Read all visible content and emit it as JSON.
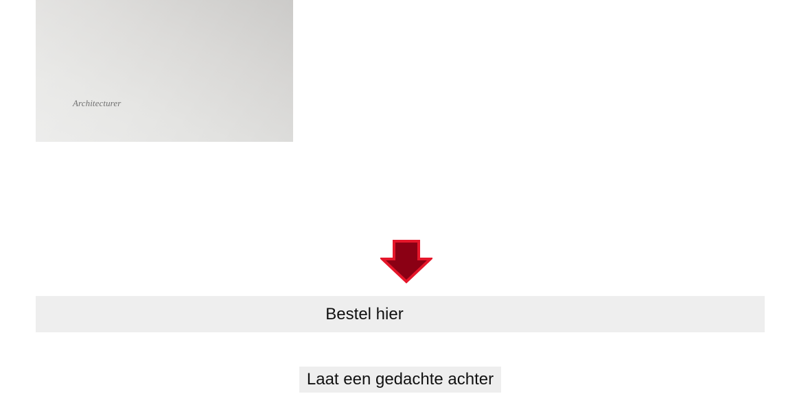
{
  "product_image": {
    "caption": "Architecturer"
  },
  "arrow": {
    "icon": "down-arrow-icon",
    "fill_color": "#8b0014",
    "stroke_color": "#e5162a"
  },
  "order": {
    "label": "Bestel hier",
    "background": "#eeeeee"
  },
  "comment": {
    "label": "Laat een gedachte achter"
  }
}
